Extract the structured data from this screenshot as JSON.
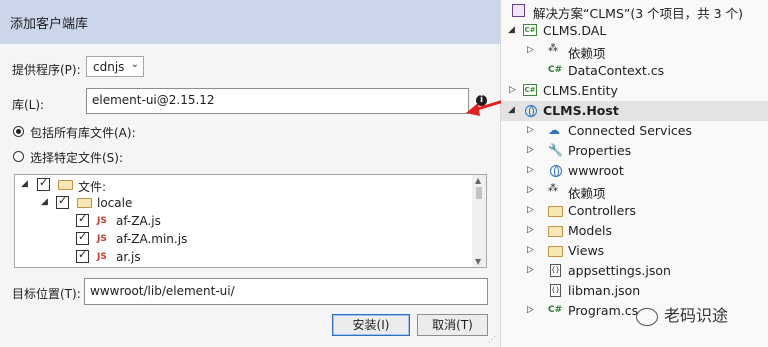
{
  "dialog": {
    "title": "添加客户端库",
    "provider_label": "提供程序(P):",
    "provider_value": "cdnjs",
    "library_label": "库(L):",
    "library_value": "element-ui@2.15.12",
    "info_glyph": "i",
    "radio_all": "包括所有库文件(A):",
    "radio_specific": "选择特定文件(S):",
    "tree": [
      {
        "label": "文件:",
        "checked": true,
        "icon": "folder-icon"
      },
      {
        "label": "locale",
        "checked": true,
        "icon": "folder-icon"
      },
      {
        "label": "af-ZA.js",
        "checked": true,
        "icon": "js-file-icon"
      },
      {
        "label": "af-ZA.min.js",
        "checked": true,
        "icon": "js-file-icon"
      },
      {
        "label": "ar.js",
        "checked": true,
        "icon": "js-file-icon"
      }
    ],
    "js_badge": "JS",
    "target_label": "目标位置(T):",
    "target_value": "wwwroot/lib/element-ui/",
    "install_button": "安装(I)",
    "cancel_button": "取消(T)",
    "accent_color": "#2f6fbd",
    "arrow_color": "#e0211c"
  },
  "solution_explorer": {
    "items": [
      {
        "label": "解决方案“CLMS”(3 个项目，共 3 个)",
        "icon": "solution-icon"
      },
      {
        "label": "CLMS.DAL",
        "icon": "csproj-icon"
      },
      {
        "label": "依赖项",
        "icon": "dependencies-icon"
      },
      {
        "label": "DataContext.cs",
        "icon": "csharp-file-icon"
      },
      {
        "label": "CLMS.Entity",
        "icon": "csproj-icon"
      },
      {
        "label": "CLMS.Host",
        "icon": "web-project-icon",
        "selected": true
      },
      {
        "label": "Connected Services",
        "icon": "connected-services-icon"
      },
      {
        "label": "Properties",
        "icon": "wrench-icon"
      },
      {
        "label": "wwwroot",
        "icon": "globe-icon"
      },
      {
        "label": "依赖项",
        "icon": "dependencies-icon"
      },
      {
        "label": "Controllers",
        "icon": "folder-icon"
      },
      {
        "label": "Models",
        "icon": "folder-icon"
      },
      {
        "label": "Views",
        "icon": "folder-icon"
      },
      {
        "label": "appsettings.json",
        "icon": "json-icon"
      },
      {
        "label": "libman.json",
        "icon": "json-icon"
      },
      {
        "label": "Program.cs",
        "icon": "csharp-file-icon"
      }
    ],
    "cs_badge": "C#",
    "json_badge": "{}",
    "watermark": "老码识途"
  }
}
